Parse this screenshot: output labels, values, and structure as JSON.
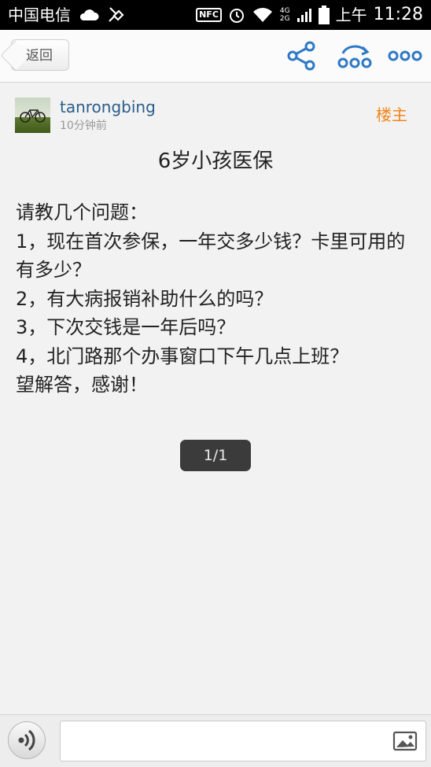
{
  "status_bar": {
    "carrier": "中国电信",
    "nfc": "NFC",
    "network_top": "4G",
    "network_bottom": "2G",
    "ampm": "上午",
    "time": "11:28"
  },
  "header": {
    "back_label": "返回",
    "icons": [
      "share-icon",
      "refresh-more-icon",
      "more-icon"
    ]
  },
  "post": {
    "username": "tanrongbing",
    "time": "10分钟前",
    "owner_tag": "楼主",
    "title": "6岁小孩医保",
    "lines": [
      "请教几个问题：",
      "1，现在首次参保，一年交多少钱？卡里可用的有多少？",
      "2，有大病报销补助什么的吗？",
      "3，下次交钱是一年后吗？",
      "4，北门路那个办事窗口下午几点上班？",
      "望解答，感谢！"
    ],
    "page_indicator": "1/1"
  },
  "bottom_bar": {
    "input_value": "",
    "icons": [
      "voice-icon",
      "image-icon"
    ]
  }
}
